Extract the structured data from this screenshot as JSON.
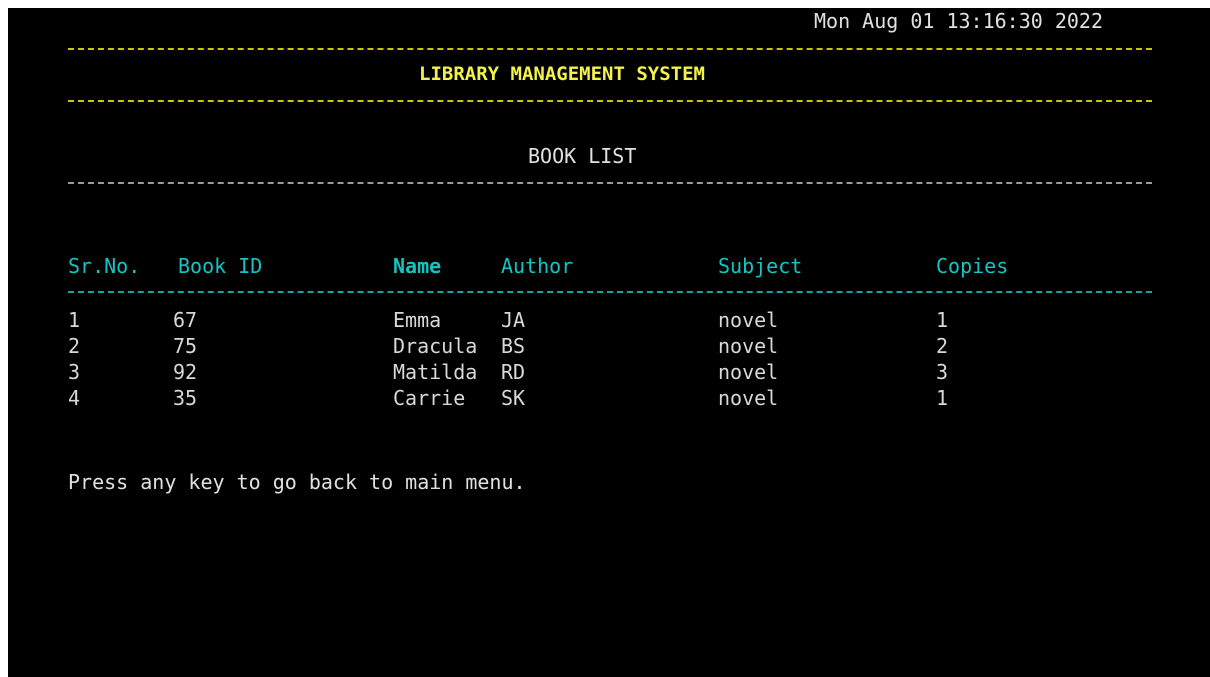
{
  "datetime": "Mon Aug 01 13:16:30 2022",
  "title": "LIBRARY MANAGEMENT SYSTEM",
  "subtitle": "BOOK LIST",
  "table": {
    "headers": [
      "Sr.No.",
      "Book ID",
      "Name",
      "Author",
      "Subject",
      "Copies"
    ],
    "rows": [
      [
        "1",
        "67",
        "Emma",
        "JA",
        "novel",
        "1"
      ],
      [
        "2",
        "75",
        "Dracula",
        "BS",
        "novel",
        "2"
      ],
      [
        "3",
        "92",
        "Matilda",
        "RD",
        "novel",
        "3"
      ],
      [
        "4",
        "35",
        "Carrie",
        "SK",
        "novel",
        "1"
      ]
    ]
  },
  "prompt": "Press any key to go back to main menu.",
  "colors": {
    "background": "#000000",
    "title": "#f2f24a",
    "header": "#14c4c4",
    "text": "#e0e0e0"
  }
}
